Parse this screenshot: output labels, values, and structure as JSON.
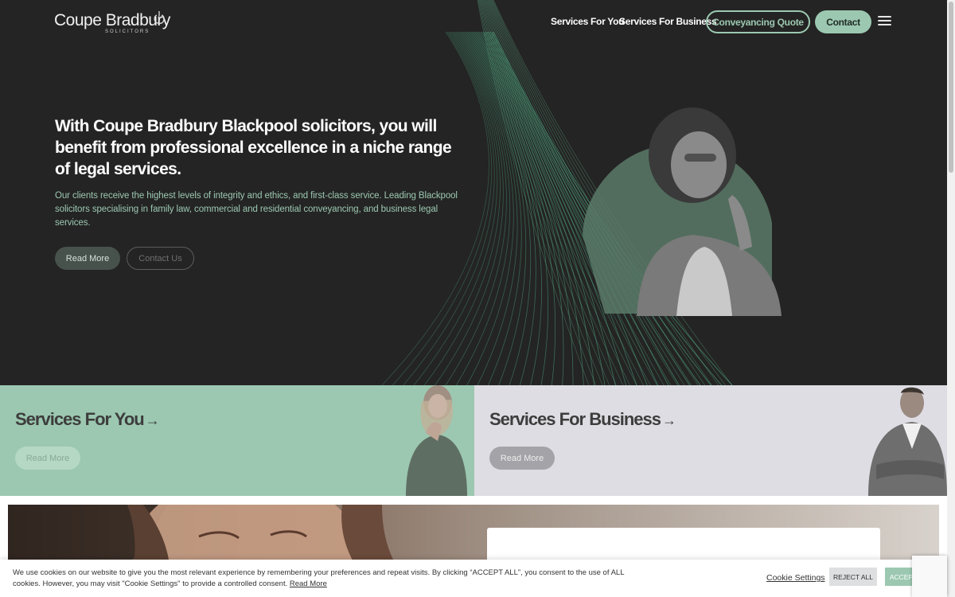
{
  "header": {
    "logo_text": "Coupe Bradbury",
    "logo_subtext": "SOLICITORS",
    "nav": [
      "Services For You",
      "Services For Business"
    ],
    "quote_label": "Conveyancing Quote",
    "contact_label": "Contact"
  },
  "hero": {
    "title": "With Coupe Bradbury Blackpool solicitors, you will benefit from professional excellence in a niche range of legal services.",
    "text": "Our clients receive the highest levels of integrity and ethics, and first-class service. Leading Blackpool solicitors specialising in family law, commercial and residential conveyancing, and business legal services.",
    "read_more": "Read More",
    "contact_us": "Contact Us"
  },
  "services": {
    "you": {
      "title": "Services For You",
      "arrow": "→",
      "button": "Read More"
    },
    "business": {
      "title": "Services For Business",
      "arrow": "→",
      "button": "Read More"
    }
  },
  "cookie": {
    "text": "We use cookies on our website to give you the most relevant experience by remembering your preferences and repeat visits. By clicking “ACCEPT ALL”, you consent to the use of ALL cookies. However, you may visit \"Cookie Settings\" to provide a controlled consent.",
    "read_more": "Read More",
    "settings": "Cookie Settings",
    "reject": "REJECT ALL",
    "accept": "ACCEPT ALL"
  },
  "colors": {
    "dark": "#242424",
    "accent": "#9cc8b1",
    "business_bg": "#dedde3"
  },
  "icons": [
    "menu-icon",
    "logo-leaf-icon",
    "arrow-right-icon"
  ]
}
